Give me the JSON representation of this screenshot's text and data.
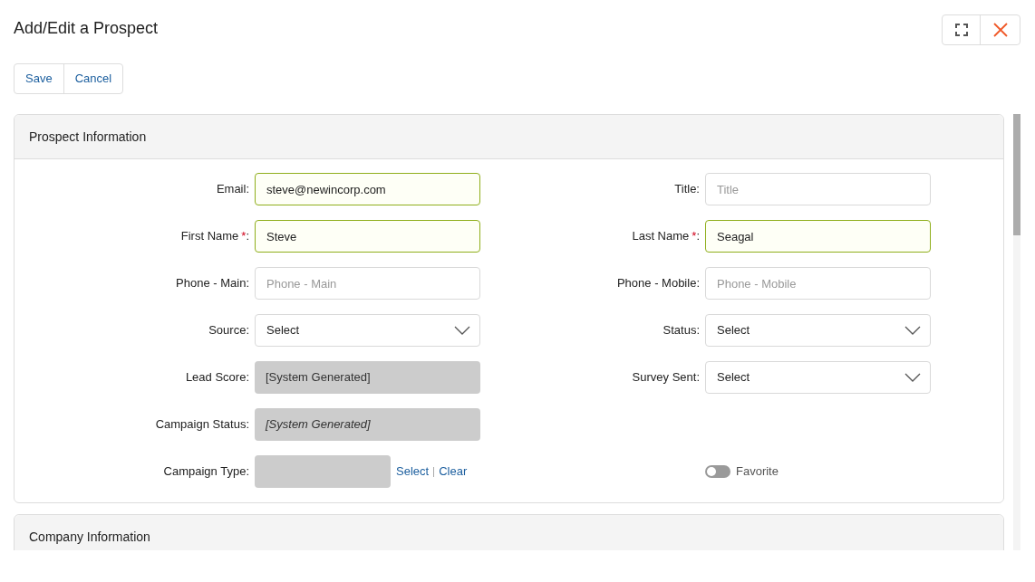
{
  "window": {
    "title": "Add/Edit a Prospect"
  },
  "toolbar": {
    "buttons": [
      "Save",
      "Cancel"
    ]
  },
  "sections": [
    {
      "title": "Prospect Information",
      "rows": [
        [
          {
            "kind": "text",
            "label": "Email:",
            "value": "steve@newincorp.com",
            "validated": true
          },
          {
            "kind": "text",
            "label": "Title:",
            "placeholder": "Title",
            "validated": false
          }
        ],
        [
          {
            "kind": "text",
            "label": "First Name",
            "required_mark": "*",
            "label_suffix": ":",
            "value": "Steve",
            "validated": true
          },
          {
            "kind": "text",
            "label": "Last Name",
            "required_mark": "*",
            "label_suffix": ":",
            "value": "Seagal",
            "validated": true
          }
        ],
        [
          {
            "kind": "text",
            "label": "Phone - Main:",
            "placeholder": "Phone - Main",
            "validated": false
          },
          {
            "kind": "text",
            "label": "Phone - Mobile:",
            "placeholder": "Phone - Mobile",
            "validated": false
          }
        ],
        [
          {
            "kind": "select",
            "label": "Source:",
            "value": "Select"
          },
          {
            "kind": "select",
            "label": "Status:",
            "value": "Select"
          }
        ],
        [
          {
            "kind": "readonly",
            "label": "Lead Score:",
            "value": "[System Generated]",
            "italic": false
          },
          {
            "kind": "select",
            "label": "Survey Sent:",
            "value": "Select"
          }
        ],
        [
          {
            "kind": "readonly",
            "label": "Campaign Status:",
            "value": "[System Generated]",
            "italic": true
          }
        ],
        [
          {
            "kind": "lookup",
            "label": "Campaign Type:",
            "links": [
              "Select",
              "Clear"
            ]
          },
          {
            "kind": "toggle",
            "text": "Favorite",
            "on": false
          }
        ]
      ]
    },
    {
      "title": "Company Information"
    }
  ]
}
